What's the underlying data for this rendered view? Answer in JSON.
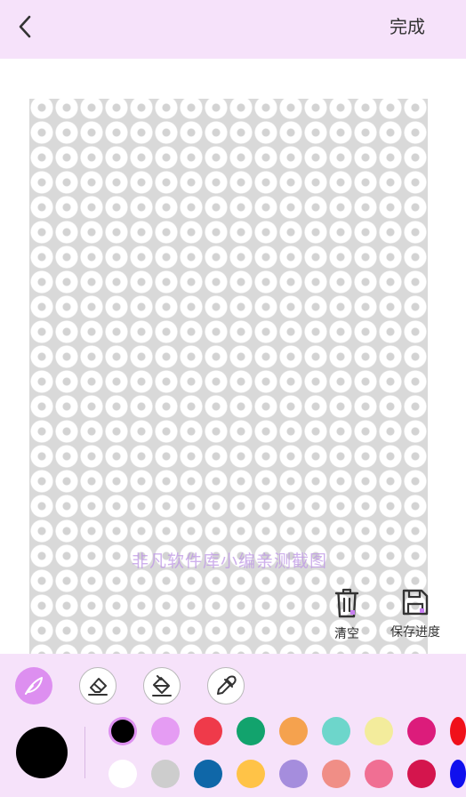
{
  "header": {
    "back_icon": "chevron-left-icon",
    "done_label": "完成"
  },
  "canvas": {
    "pattern": "white-ring-dots-on-gray",
    "watermark": "非凡软件库小编亲测截图"
  },
  "actions": {
    "clear_label": "清空",
    "clear_icon": "trash-icon",
    "save_label": "保存进度",
    "save_icon": "save-disk-icon"
  },
  "tools": [
    {
      "name": "brush",
      "icon": "feather-brush-icon",
      "active": true
    },
    {
      "name": "eraser",
      "icon": "eraser-icon",
      "active": false
    },
    {
      "name": "fill",
      "icon": "paint-bucket-icon",
      "active": false
    },
    {
      "name": "picker",
      "icon": "eyedropper-icon",
      "active": false
    }
  ],
  "current_color": "#000000",
  "palette": {
    "row1": [
      "#000000",
      "#e59cf3",
      "#ef3a4a",
      "#12a36d",
      "#f5a24e",
      "#6dd6cb",
      "#f3ec9c",
      "#dc1c7b",
      "#f0101a"
    ],
    "row2": [
      "#ffffff",
      "#cdcdcd",
      "#0f67a8",
      "#ffc347",
      "#a58ddd",
      "#f08e86",
      "#f06f93",
      "#d4154d",
      "#1010ee"
    ],
    "selected": "#000000"
  },
  "colors": {
    "accent": "#dd8ff0",
    "bar_background": "#f6e2fa"
  }
}
